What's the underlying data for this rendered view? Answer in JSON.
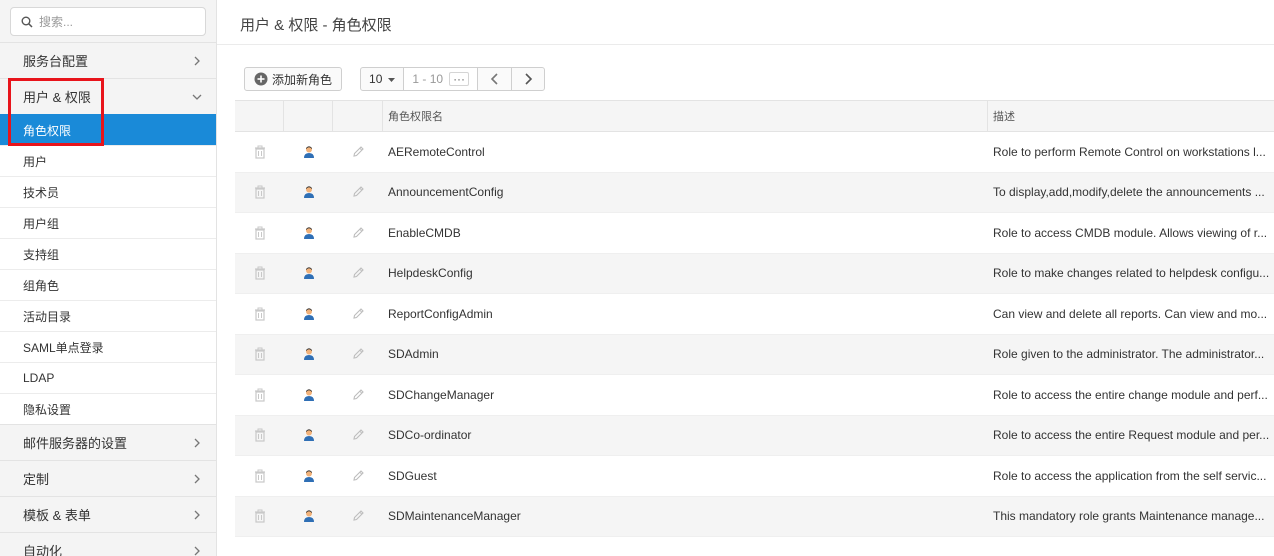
{
  "search": {
    "placeholder": "搜索..."
  },
  "sidebar": {
    "cat_service_desk": "服务台配置",
    "cat_users_perms": "用户 & 权限",
    "sub_items": [
      "角色权限",
      "用户",
      "技术员",
      "用户组",
      "支持组",
      "组角色",
      "活动目录",
      "SAML单点登录",
      "LDAP",
      "隐私设置"
    ],
    "cat_mail_server": "邮件服务器的设置",
    "cat_customize": "定制",
    "cat_templates": "模板 & 表单",
    "cat_automation": "自动化"
  },
  "header": {
    "title": "用户 & 权限 - 角色权限"
  },
  "toolbar": {
    "add_label": "添加新角色",
    "page_size": "10",
    "range": "1 - 10",
    "more": "···"
  },
  "table": {
    "col_name": "角色权限名",
    "col_desc": "描述",
    "rows": [
      {
        "name": "AERemoteControl",
        "desc": "Role to perform Remote Control on workstations l..."
      },
      {
        "name": "AnnouncementConfig",
        "desc": "To display,add,modify,delete the announcements ..."
      },
      {
        "name": "EnableCMDB",
        "desc": "Role to access CMDB module. Allows viewing of r..."
      },
      {
        "name": "HelpdeskConfig",
        "desc": "Role to make changes related to helpdesk configu..."
      },
      {
        "name": "ReportConfigAdmin",
        "desc": "Can view and delete all reports. Can view and mo..."
      },
      {
        "name": "SDAdmin",
        "desc": "Role given to the administrator. The administrator..."
      },
      {
        "name": "SDChangeManager",
        "desc": "Role to access the entire change module and perf..."
      },
      {
        "name": "SDCo-ordinator",
        "desc": "Role to access the entire Request module and per..."
      },
      {
        "name": "SDGuest",
        "desc": "Role to access the application from the self servic..."
      },
      {
        "name": "SDMaintenanceManager",
        "desc": "This mandatory role grants Maintenance manage..."
      }
    ]
  },
  "colors": {
    "accent": "#1a8ad8",
    "highlight": "#e8141b"
  }
}
